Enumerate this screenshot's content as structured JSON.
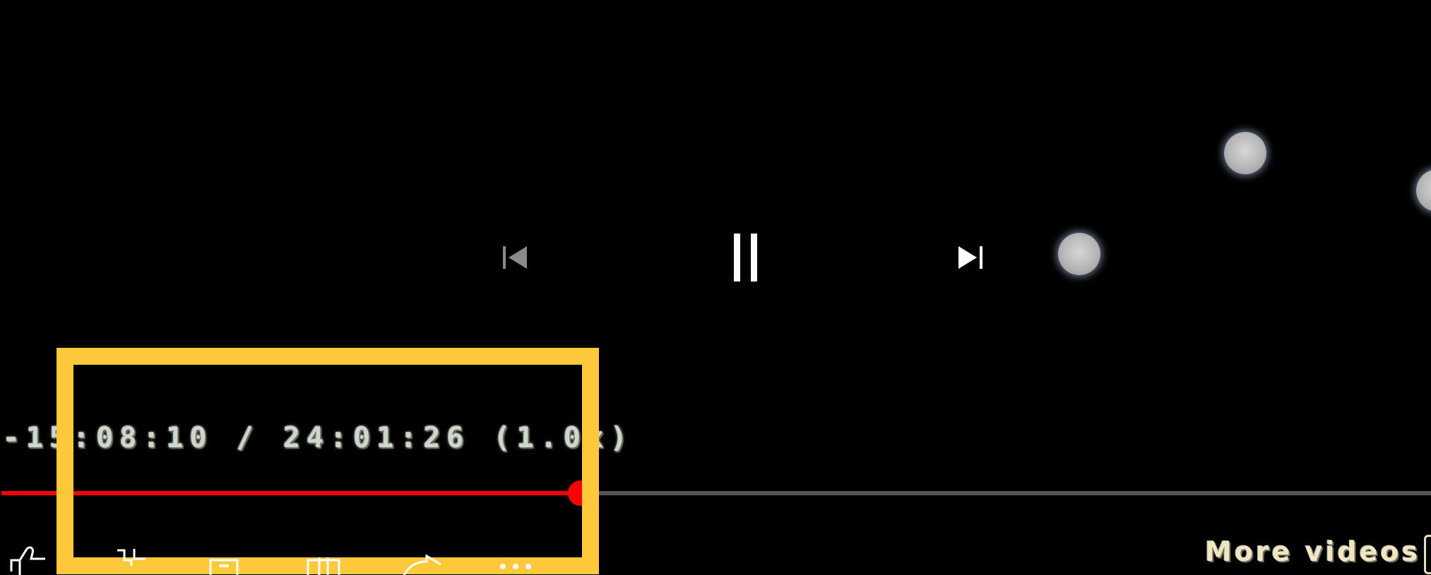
{
  "player": {
    "time_text": "-15:08:10 / 24:01:26 (1.0x)",
    "progress_fraction": 0.405,
    "more_videos_label": "More videos"
  },
  "controls": {
    "prev_icon": "skip-previous-icon",
    "pause_icon": "pause-icon",
    "next_icon": "skip-next-icon"
  },
  "actions": [
    "like-icon",
    "dislike-icon",
    "save-icon",
    "add-to-playlist-icon",
    "share-icon",
    "more-icon"
  ],
  "colors": {
    "progress_played": "#ff0000",
    "progress_track": "#555555",
    "highlight": "#fdc93a",
    "background": "#000000"
  }
}
